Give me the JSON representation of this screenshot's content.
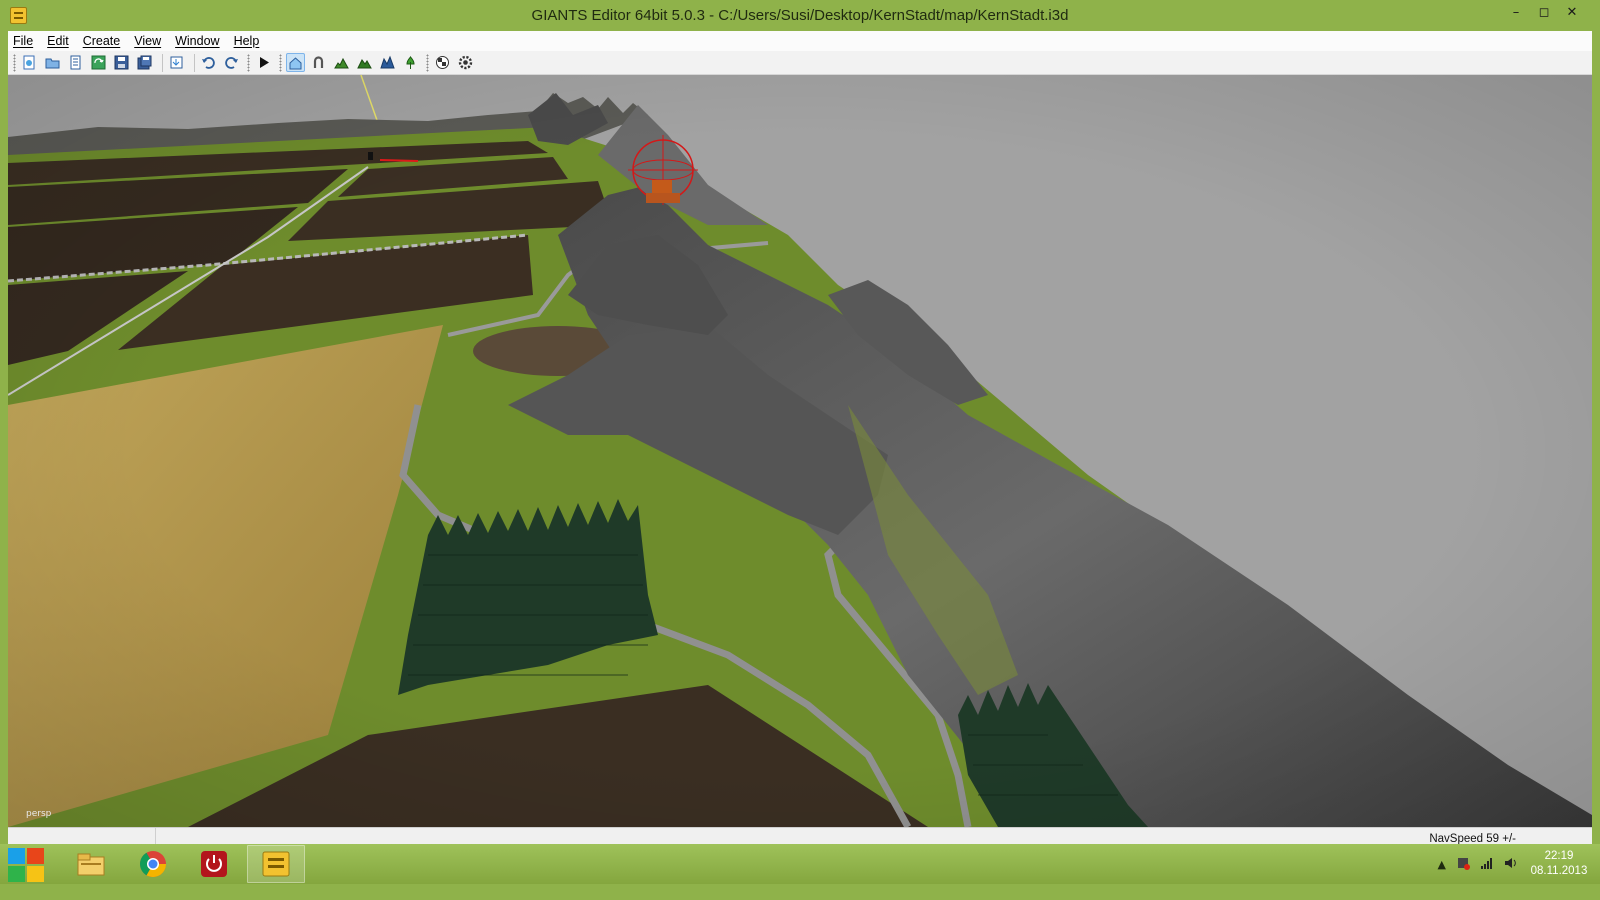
{
  "window": {
    "title": "GIANTS Editor 64bit 5.0.3 - C:/Users/Susi/Desktop/KernStadt/map/KernStadt.i3d",
    "controls": {
      "minimize": "–",
      "maximize": "◻",
      "close": "✕"
    }
  },
  "menu": {
    "items": [
      "File",
      "Edit",
      "Create",
      "View",
      "Window",
      "Help"
    ]
  },
  "toolbar": {
    "buttons": [
      {
        "name": "new-scene",
        "icon": "new-file-icon"
      },
      {
        "name": "open",
        "icon": "folder-open-icon"
      },
      {
        "name": "properties",
        "icon": "document-list-icon"
      },
      {
        "name": "reload",
        "icon": "refresh-icon"
      },
      {
        "name": "save",
        "icon": "save-icon"
      },
      {
        "name": "save-all",
        "icon": "save-all-icon"
      },
      {
        "name": "import",
        "icon": "import-icon"
      },
      {
        "name": "undo",
        "icon": "undo-icon"
      },
      {
        "name": "redo",
        "icon": "redo-icon"
      },
      {
        "name": "play",
        "icon": "play-icon"
      },
      {
        "name": "select-mode",
        "icon": "home-icon",
        "active": true
      },
      {
        "name": "move-mode",
        "icon": "magnet-icon"
      },
      {
        "name": "terrain-sculpt",
        "icon": "terrain-icon"
      },
      {
        "name": "terrain-paint",
        "icon": "terrain-paint-icon"
      },
      {
        "name": "terrain-texture",
        "icon": "terrain-texture-icon"
      },
      {
        "name": "foliage-paint",
        "icon": "foliage-icon"
      },
      {
        "name": "settings",
        "icon": "checker-gear-icon"
      },
      {
        "name": "render-settings",
        "icon": "gear-icon"
      }
    ]
  },
  "viewport": {
    "camera_label": "persp",
    "sky_color": "#a2a2a2",
    "grass_color": "#6e8c2c",
    "field_color": "#3a2e22",
    "wheat_color": "#b59a4a",
    "rock_color": "#505050"
  },
  "status": {
    "navspeed": "NavSpeed 59 +/-"
  },
  "taskbar": {
    "apps": [
      {
        "name": "file-explorer",
        "icon": "folder-icon"
      },
      {
        "name": "chrome",
        "icon": "chrome-icon"
      },
      {
        "name": "shutdown",
        "icon": "power-icon"
      },
      {
        "name": "giants-editor",
        "icon": "giants-editor-icon",
        "open": true
      }
    ],
    "clock": {
      "time": "22:19",
      "date": "08.11.2013"
    }
  },
  "colors": {
    "accent": "#8fb24a",
    "active_button": "#cce4f7"
  }
}
